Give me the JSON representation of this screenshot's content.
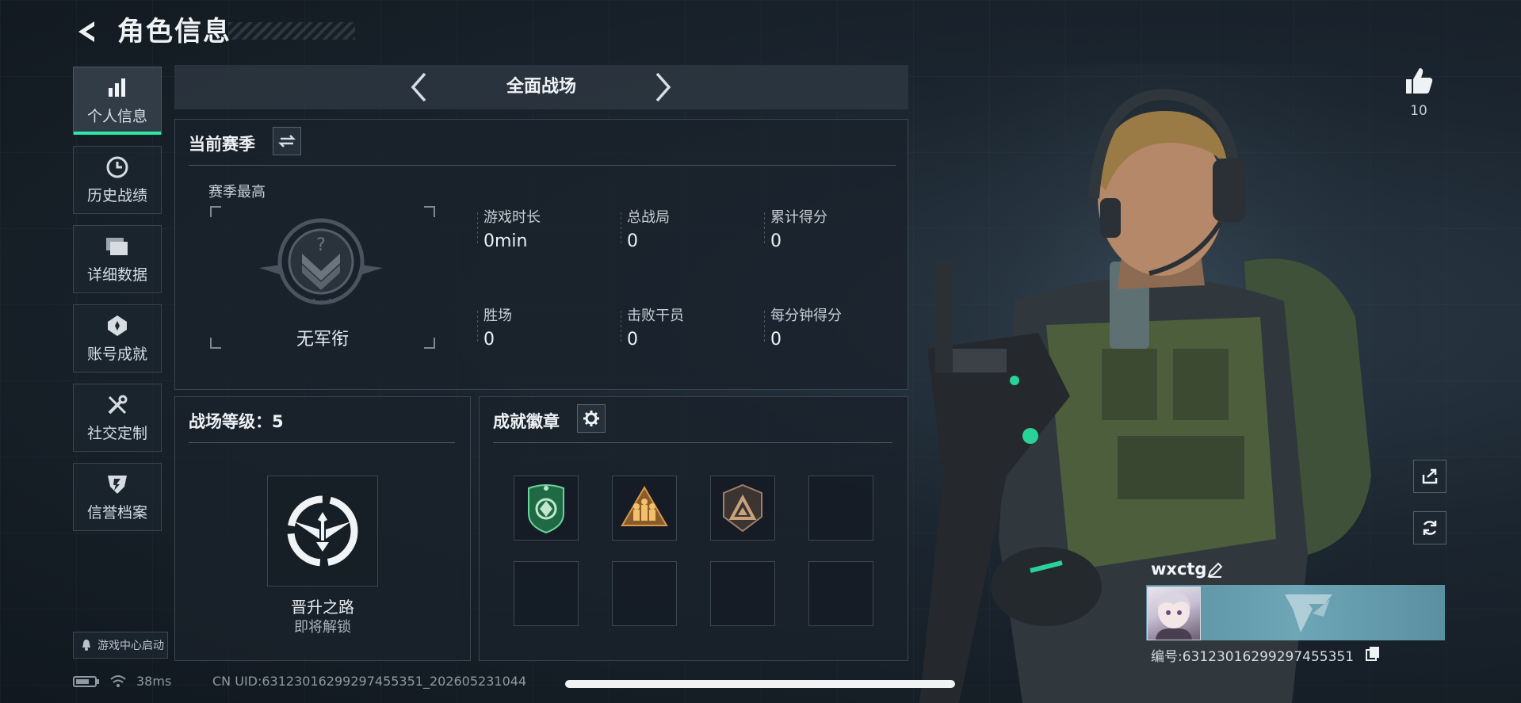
{
  "header": {
    "title": "角色信息"
  },
  "sidebar": {
    "items": [
      {
        "label": "个人信息",
        "icon": "bar-chart-icon",
        "active": true
      },
      {
        "label": "历史战绩",
        "icon": "clock-icon",
        "active": false
      },
      {
        "label": "详细数据",
        "icon": "folder-icon",
        "active": false
      },
      {
        "label": "账号成就",
        "icon": "achievement-icon",
        "active": false
      },
      {
        "label": "社交定制",
        "icon": "tools-icon",
        "active": false
      },
      {
        "label": "信誉档案",
        "icon": "shield-icon",
        "active": false
      }
    ],
    "gamecenter_label": "游戏中心启动"
  },
  "mode": {
    "title": "全面战场"
  },
  "season": {
    "title": "当前赛季",
    "best_label": "赛季最高",
    "rank_name": "无军衔",
    "stats": [
      {
        "label": "游戏时长",
        "value": "0min"
      },
      {
        "label": "总战局",
        "value": "0"
      },
      {
        "label": "累计得分",
        "value": "0"
      },
      {
        "label": "胜场",
        "value": "0"
      },
      {
        "label": "击败干员",
        "value": "0"
      },
      {
        "label": "每分钟得分",
        "value": "0"
      }
    ]
  },
  "level": {
    "title": "战场等级：5",
    "path_name": "晋升之路",
    "path_status": "即将解锁"
  },
  "badges": {
    "title": "成就徽章",
    "slots": [
      {
        "icon": "green-shield-badge-icon",
        "filled": true
      },
      {
        "icon": "gold-soldiers-badge-icon",
        "filled": true
      },
      {
        "icon": "bronze-triangle-badge-icon",
        "filled": true
      },
      {
        "icon": "",
        "filled": false
      },
      {
        "icon": "",
        "filled": false
      },
      {
        "icon": "",
        "filled": false
      },
      {
        "icon": "",
        "filled": false
      },
      {
        "icon": "",
        "filled": false
      }
    ]
  },
  "profile": {
    "likes": "10",
    "username": "wxctg",
    "id_line": "编号:63123016299297455351"
  },
  "status": {
    "latency": "38ms",
    "cn_uid": "CN UID:63123016299297455351_202605231044"
  },
  "colors": {
    "accent": "#2ee7a8",
    "panel_bg": "#1a222b",
    "namecard": "#6ea6b6"
  }
}
